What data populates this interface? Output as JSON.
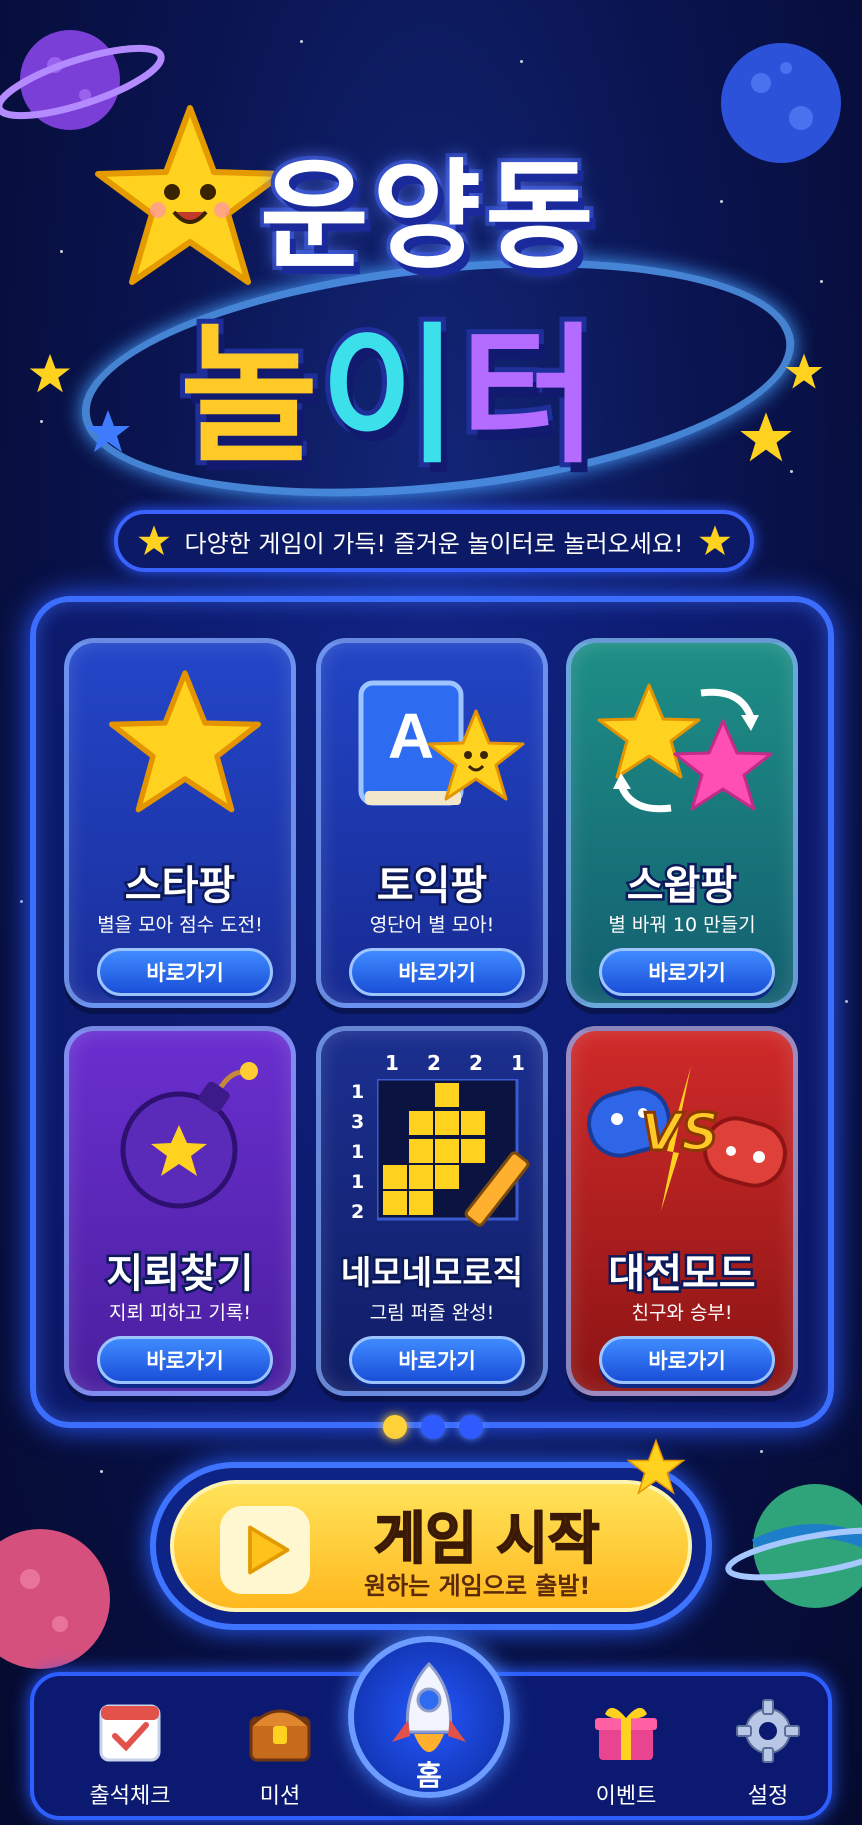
{
  "title": {
    "line1": "운양동",
    "line2_a": "놀",
    "line2_b": "이",
    "line2_c": "터"
  },
  "subtitle": "다양한 게임이 가득! 즐거운 놀이터로 놀러오세요!",
  "games": [
    {
      "name": "스타팡",
      "desc": "별을 모아 점수 도전!",
      "button": "바로가기",
      "icon": "star-icon"
    },
    {
      "name": "토익팡",
      "desc": "영단어 별 모아!",
      "button": "바로가기",
      "icon": "book-star-icon"
    },
    {
      "name": "스왑팡",
      "desc": "별 바꿔 10 만들기",
      "button": "바로가기",
      "icon": "swap-stars-icon"
    },
    {
      "name": "지뢰찾기",
      "desc": "지뢰 피하고 기록!",
      "button": "바로가기",
      "icon": "bomb-icon"
    },
    {
      "name": "네모네모로직",
      "desc": "그림 퍼즐 완성!",
      "button": "바로가기",
      "icon": "nonogram-icon",
      "col_clues": [
        "1",
        "2",
        "2",
        "1"
      ],
      "row_clues": [
        "1",
        "3",
        "1",
        "1",
        "2"
      ]
    },
    {
      "name": "대전모드",
      "desc": "친구와 승부!",
      "button": "바로가기",
      "icon": "versus-controllers-icon",
      "vs": "VS"
    }
  ],
  "pagination": {
    "pages": 3,
    "active": 0
  },
  "start": {
    "title": "게임 시작",
    "subtitle": "원하는 게임으로 출발!"
  },
  "nav": {
    "items": [
      {
        "label": "출석체크",
        "icon": "calendar-check-icon"
      },
      {
        "label": "미션",
        "icon": "treasure-chest-icon"
      },
      {
        "label": "홈",
        "icon": "rocket-icon"
      },
      {
        "label": "이벤트",
        "icon": "gift-icon"
      },
      {
        "label": "설정",
        "icon": "gear-icon"
      }
    ]
  },
  "colors": {
    "accent_blue": "#3b6dff",
    "yellow": "#ffc928",
    "cyan": "#3be0ea",
    "purple": "#b46bff"
  }
}
